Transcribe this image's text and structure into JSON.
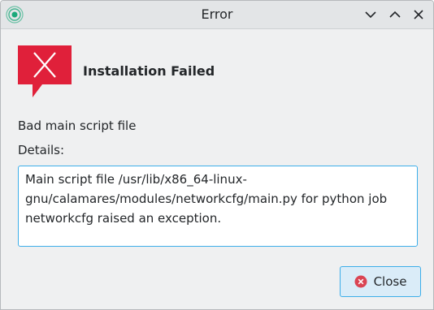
{
  "window": {
    "title": "Error"
  },
  "dialog": {
    "heading": "Installation Failed",
    "message": "Bad main script file",
    "details_label": "Details:",
    "details_text": "Main script file /usr/lib/x86_64-linux-gnu/calamares/modules/networkcfg/main.py for python job networkcfg raised an exception.",
    "close_label": "Close"
  },
  "icons": {
    "app": "calamares-app-icon",
    "minimize": "chevron-down-icon",
    "maximize": "chevron-up-icon",
    "close": "close-icon",
    "error": "error-icon",
    "button_close": "close-circle-icon"
  },
  "colors": {
    "error_red": "#e0203a",
    "accent": "#3daee9",
    "button_bg": "#daecf8",
    "close_icon_red": "#da4453"
  }
}
